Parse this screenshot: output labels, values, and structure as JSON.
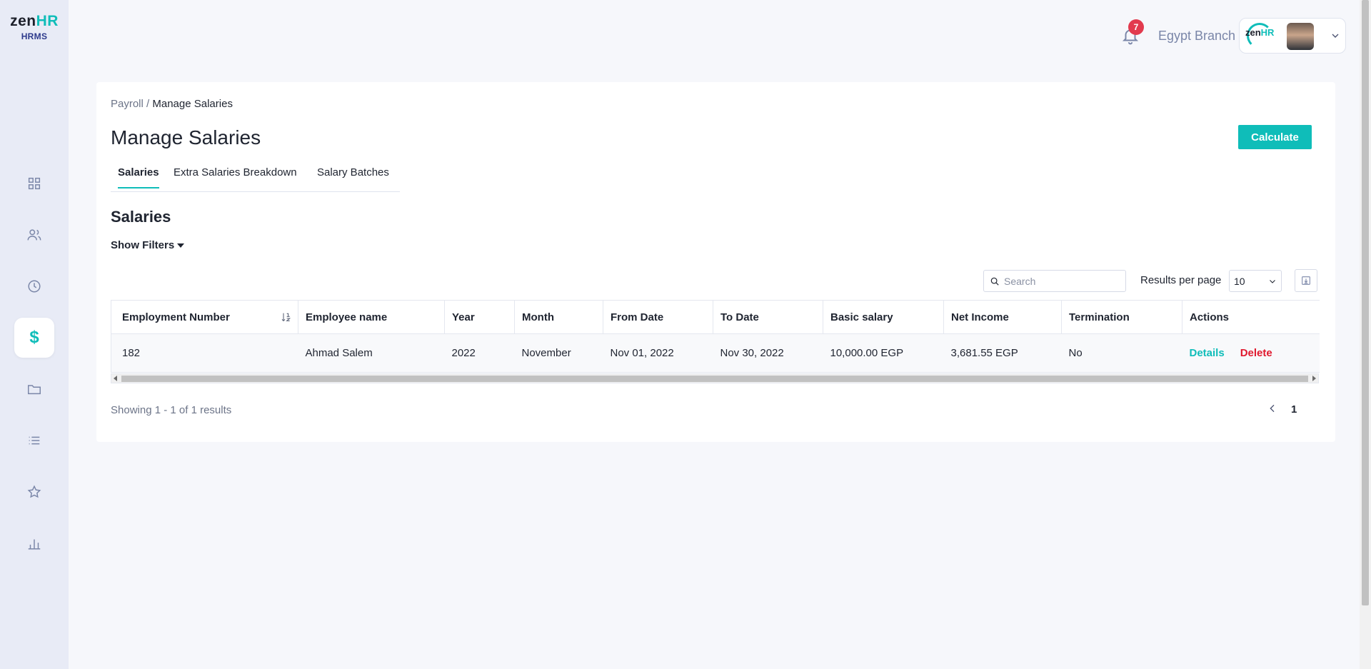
{
  "brand": {
    "name_main": "zen",
    "name_accent": "HR",
    "subtitle": "HRMS",
    "accent_color": "#0fbdb9"
  },
  "sidebar": {
    "items": [
      {
        "icon": "dashboard-icon",
        "active": false
      },
      {
        "icon": "users-icon",
        "active": false
      },
      {
        "icon": "clock-icon",
        "active": false
      },
      {
        "icon": "dollar-icon",
        "active": true,
        "glyph": "$"
      },
      {
        "icon": "folder-icon",
        "active": false
      },
      {
        "icon": "list-icon",
        "active": false
      },
      {
        "icon": "star-icon",
        "active": false
      },
      {
        "icon": "bar-chart-icon",
        "active": false
      }
    ]
  },
  "header": {
    "notifications_count": "7",
    "branch": "Egypt Branch",
    "company_logo_main": "zen",
    "company_logo_accent": "HR"
  },
  "breadcrumb": {
    "parent": "Payroll",
    "separator": " / ",
    "current": "Manage Salaries"
  },
  "page": {
    "title": "Manage Salaries",
    "calculate_label": "Calculate"
  },
  "tabs": [
    {
      "label": "Salaries",
      "active": true
    },
    {
      "label": "Extra Salaries Breakdown",
      "active": false
    },
    {
      "label": "Salary Batches",
      "active": false
    }
  ],
  "section": {
    "title": "Salaries",
    "filters_label": "Show Filters"
  },
  "toolbar": {
    "search_placeholder": "Search",
    "results_per_page_label": "Results per page",
    "results_per_page_value": "10"
  },
  "table": {
    "columns": [
      "Employment Number",
      "Employee name",
      "Year",
      "Month",
      "From Date",
      "To Date",
      "Basic salary",
      "Net Income",
      "Termination",
      "Actions"
    ],
    "rows": [
      {
        "employment_number": "182",
        "employee_name": "Ahmad Salem",
        "year": "2022",
        "month": "November",
        "from_date": "Nov 01, 2022",
        "to_date": "Nov 30, 2022",
        "basic_salary": "10,000.00 EGP",
        "net_income": "3,681.55 EGP",
        "termination": "No",
        "details_label": "Details",
        "delete_label": "Delete"
      }
    ]
  },
  "footer": {
    "showing": "Showing 1 - 1 of 1 results",
    "current_page": "1"
  }
}
